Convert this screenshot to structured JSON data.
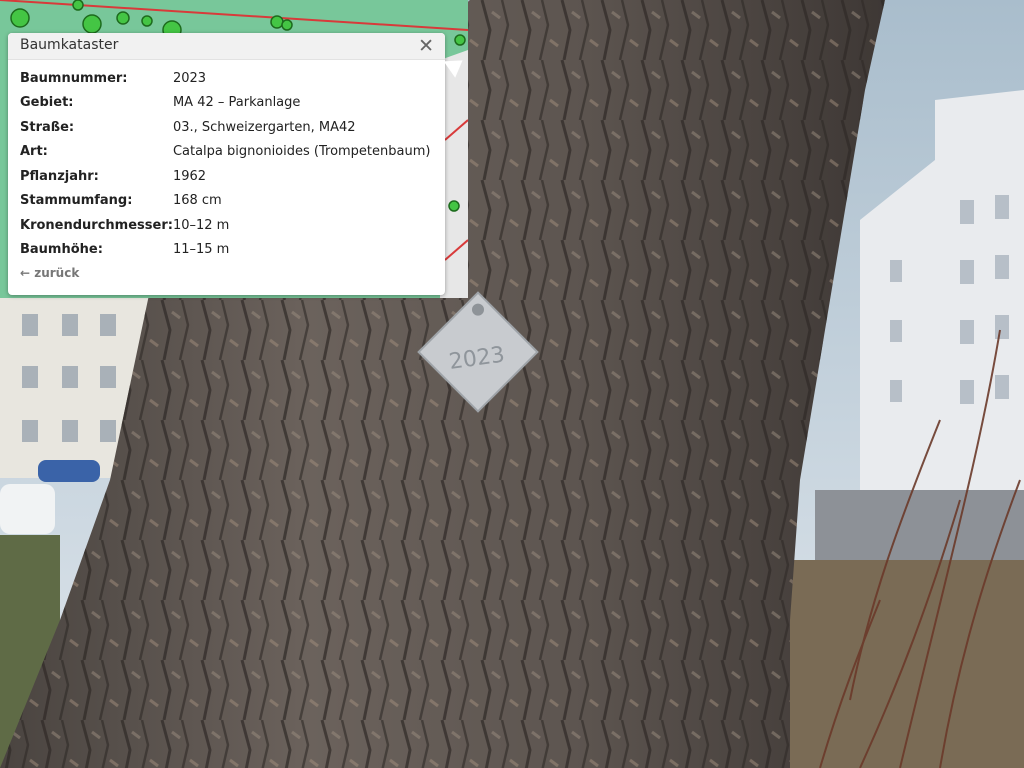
{
  "popup": {
    "title": "Baumkataster",
    "close_icon": "close-icon",
    "rows": [
      {
        "key": "Baumnummer:",
        "value": "2023"
      },
      {
        "key": "Gebiet:",
        "value": "MA 42 – Parkanlage"
      },
      {
        "key": "Straße:",
        "value": "03., Schweizergarten, MA42"
      },
      {
        "key": "Art:",
        "value": "Catalpa bignonioides (Trompetenbaum)"
      },
      {
        "key": "Pflanzjahr:",
        "value": "1962"
      },
      {
        "key": "Stammumfang:",
        "value": "168 cm"
      },
      {
        "key": "Kronendurchmesser:",
        "value": "10–12 m"
      },
      {
        "key": "Baumhöhe:",
        "value": "11–15 m"
      }
    ],
    "back_label": "← zurück"
  },
  "colors": {
    "map_green": "#6fbf8f",
    "map_tree_marker": "#44c544",
    "map_road": "#d83a3a"
  }
}
